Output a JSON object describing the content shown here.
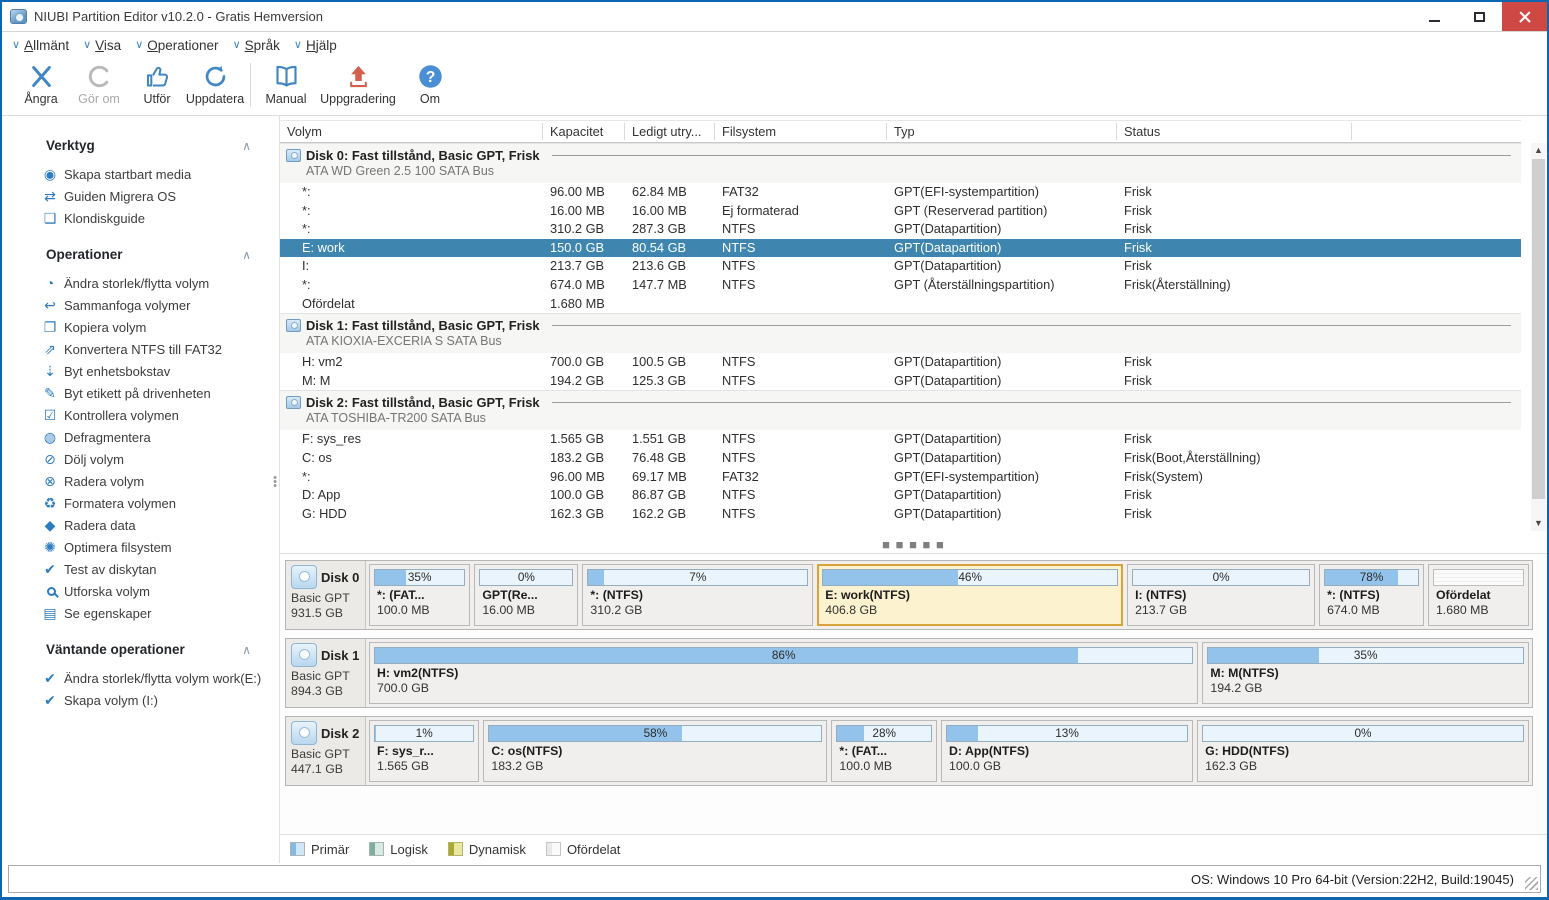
{
  "window": {
    "title": "NIUBI Partition Editor v10.2.0 - Gratis Hemversion"
  },
  "colors": {
    "selected_row": "#3e86af",
    "highlight_border": "#d8a33c",
    "bar_fill": "#93c3ea",
    "close_button": "#cf4944",
    "icon_blue": "#2e7cc0",
    "upgrade_red": "#d2604d"
  },
  "menu": {
    "items": [
      {
        "label": "Allmänt"
      },
      {
        "label": "Visa"
      },
      {
        "label": "Operationer"
      },
      {
        "label": "Språk"
      },
      {
        "label": "Hjälp"
      }
    ]
  },
  "toolbar": {
    "buttons": [
      {
        "label": "Ångra",
        "icon": "undo-icon",
        "enabled": true
      },
      {
        "label": "Gör om",
        "icon": "redo-icon",
        "enabled": false
      },
      {
        "label": "Utför",
        "icon": "apply-thumbsup-icon",
        "enabled": true
      },
      {
        "label": "Uppdatera",
        "icon": "refresh-icon",
        "enabled": true
      },
      {
        "label": "Manual",
        "icon": "manual-book-icon",
        "enabled": true
      },
      {
        "label": "Uppgradering",
        "icon": "upgrade-arrow-icon",
        "enabled": true
      },
      {
        "label": "Om",
        "icon": "about-question-icon",
        "enabled": true
      }
    ]
  },
  "sidebar": {
    "sections": [
      {
        "title": "Verktyg",
        "items": [
          {
            "label": "Skapa startbart media",
            "icon": "bootable-media-icon"
          },
          {
            "label": "Guiden Migrera OS",
            "icon": "migrate-os-icon"
          },
          {
            "label": "Klondiskguide",
            "icon": "clone-disk-icon"
          }
        ]
      },
      {
        "title": "Operationer",
        "items": [
          {
            "label": "Ändra storlek/flytta volym",
            "icon": "resize-move-icon"
          },
          {
            "label": "Sammanfoga volymer",
            "icon": "merge-volumes-icon"
          },
          {
            "label": "Kopiera volym",
            "icon": "copy-volume-icon"
          },
          {
            "label": "Konvertera NTFS till FAT32",
            "icon": "convert-ntfs-icon"
          },
          {
            "label": "Byt enhetsbokstav",
            "icon": "change-drive-letter-icon"
          },
          {
            "label": "Byt etikett på drivenheten",
            "icon": "change-label-icon"
          },
          {
            "label": "Kontrollera volymen",
            "icon": "check-volume-icon"
          },
          {
            "label": "Defragmentera",
            "icon": "defragment-icon"
          },
          {
            "label": "Dölj volym",
            "icon": "hide-volume-icon"
          },
          {
            "label": "Radera volym",
            "icon": "delete-volume-icon"
          },
          {
            "label": "Formatera volymen",
            "icon": "format-volume-icon"
          },
          {
            "label": "Radera data",
            "icon": "wipe-data-icon"
          },
          {
            "label": "Optimera filsystem",
            "icon": "optimize-filesystem-icon"
          },
          {
            "label": "Test av diskytan",
            "icon": "surface-test-icon"
          },
          {
            "label": "Utforska volym",
            "icon": "explore-volume-icon"
          },
          {
            "label": "Se egenskaper",
            "icon": "properties-icon"
          }
        ]
      },
      {
        "title": "Väntande operationer",
        "items": [
          {
            "label": "Ändra storlek/flytta volym  work(E:)",
            "icon": "pending-check-icon"
          },
          {
            "label": "Skapa volym (I:)",
            "icon": "pending-check-icon"
          }
        ]
      }
    ]
  },
  "table": {
    "columns": [
      "Volym",
      "Kapacitet",
      "Ledigt utry...",
      "Filsystem",
      "Typ",
      "Status"
    ],
    "groups": [
      {
        "title": "Disk 0: Fast tillstånd, Basic GPT, Frisk",
        "subtitle": "ATA WD Green 2.5 100 SATA Bus",
        "rows": [
          {
            "volym": "*:",
            "kapacitet": "96.00 MB",
            "ledigt": "62.84 MB",
            "filsystem": "FAT32",
            "typ": "GPT(EFI-systempartition)",
            "status": "Frisk"
          },
          {
            "volym": "*:",
            "kapacitet": "16.00 MB",
            "ledigt": "16.00 MB",
            "filsystem": "Ej formaterad",
            "typ": "GPT (Reserverad partition)",
            "status": "Frisk"
          },
          {
            "volym": "*:",
            "kapacitet": "310.2 GB",
            "ledigt": "287.3 GB",
            "filsystem": "NTFS",
            "typ": "GPT(Datapartition)",
            "status": "Frisk"
          },
          {
            "volym": "E: work",
            "kapacitet": "150.0 GB",
            "ledigt": "80.54 GB",
            "filsystem": "NTFS",
            "typ": "GPT(Datapartition)",
            "status": "Frisk"
          },
          {
            "volym": "I:",
            "kapacitet": "213.7 GB",
            "ledigt": "213.6 GB",
            "filsystem": "NTFS",
            "typ": "GPT(Datapartition)",
            "status": "Frisk"
          },
          {
            "volym": "*:",
            "kapacitet": "674.0 MB",
            "ledigt": "147.7 MB",
            "filsystem": "NTFS",
            "typ": "GPT (Återställningspartition)",
            "status": "Frisk(Återställning)"
          },
          {
            "volym": "Ofördelat",
            "kapacitet": "1.680 MB",
            "ledigt": "",
            "filsystem": "",
            "typ": "",
            "status": ""
          }
        ]
      },
      {
        "title": "Disk 1: Fast tillstånd, Basic GPT, Frisk",
        "subtitle": "ATA KIOXIA-EXCERIA S SATA Bus",
        "rows": [
          {
            "volym": "H: vm2",
            "kapacitet": "700.0 GB",
            "ledigt": "100.5 GB",
            "filsystem": "NTFS",
            "typ": "GPT(Datapartition)",
            "status": "Frisk"
          },
          {
            "volym": "M: M",
            "kapacitet": "194.2 GB",
            "ledigt": "125.3 GB",
            "filsystem": "NTFS",
            "typ": "GPT(Datapartition)",
            "status": "Frisk"
          }
        ]
      },
      {
        "title": "Disk 2: Fast tillstånd, Basic GPT, Frisk",
        "subtitle": "ATA TOSHIBA-TR200 SATA Bus",
        "rows": [
          {
            "volym": "F: sys_res",
            "kapacitet": "1.565 GB",
            "ledigt": "1.551 GB",
            "filsystem": "NTFS",
            "typ": "GPT(Datapartition)",
            "status": "Frisk"
          },
          {
            "volym": "C: os",
            "kapacitet": "183.2 GB",
            "ledigt": "76.48 GB",
            "filsystem": "NTFS",
            "typ": "GPT(Datapartition)",
            "status": "Frisk(Boot,Återställning)"
          },
          {
            "volym": "*:",
            "kapacitet": "96.00 MB",
            "ledigt": "69.17 MB",
            "filsystem": "FAT32",
            "typ": "GPT(EFI-systempartition)",
            "status": "Frisk(System)"
          },
          {
            "volym": "D: App",
            "kapacitet": "100.0 GB",
            "ledigt": "86.87 GB",
            "filsystem": "NTFS",
            "typ": "GPT(Datapartition)",
            "status": "Frisk"
          },
          {
            "volym": "G: HDD",
            "kapacitet": "162.3 GB",
            "ledigt": "162.2 GB",
            "filsystem": "NTFS",
            "typ": "GPT(Datapartition)",
            "status": "Frisk"
          }
        ]
      }
    ]
  },
  "diskmap": {
    "disks": [
      {
        "name": "Disk 0",
        "layout": "Basic GPT",
        "size": "931.5 GB",
        "partitions": [
          {
            "label": "*: (FAT...",
            "size": "100.0 MB",
            "pct": "35%"
          },
          {
            "label": "GPT(Re...",
            "size": "16.00 MB",
            "pct": "0%"
          },
          {
            "label": "*: (NTFS)",
            "size": "310.2 GB",
            "pct": "7%"
          },
          {
            "label": "E: work(NTFS)",
            "size": "406.8 GB",
            "pct": "46%"
          },
          {
            "label": "I: (NTFS)",
            "size": "213.7 GB",
            "pct": "0%"
          },
          {
            "label": "*: (NTFS)",
            "size": "674.0 MB",
            "pct": "78%"
          },
          {
            "label": "Ofördelat",
            "size": "1.680 MB"
          }
        ]
      },
      {
        "name": "Disk 1",
        "layout": "Basic GPT",
        "size": "894.3 GB",
        "partitions": [
          {
            "label": "H: vm2(NTFS)",
            "size": "700.0 GB",
            "pct": "86%"
          },
          {
            "label": "M: M(NTFS)",
            "size": "194.2 GB",
            "pct": "35%"
          }
        ]
      },
      {
        "name": "Disk 2",
        "layout": "Basic GPT",
        "size": "447.1 GB",
        "partitions": [
          {
            "label": "F: sys_r...",
            "size": "1.565 GB",
            "pct": "1%"
          },
          {
            "label": "C: os(NTFS)",
            "size": "183.2 GB",
            "pct": "58%"
          },
          {
            "label": "*: (FAT...",
            "size": "100.0 MB",
            "pct": "28%"
          },
          {
            "label": "D: App(NTFS)",
            "size": "100.0 GB",
            "pct": "13%"
          },
          {
            "label": "G: HDD(NTFS)",
            "size": "162.3 GB",
            "pct": "0%"
          }
        ]
      }
    ]
  },
  "legend": {
    "items": [
      {
        "label": "Primär",
        "color": "#cfe7f9"
      },
      {
        "label": "Logisk",
        "color": "#d9e9e3"
      },
      {
        "label": "Dynamisk",
        "color": "#e8e89e"
      },
      {
        "label": "Ofördelat",
        "color": "#fafafa"
      }
    ]
  },
  "statusbar": {
    "os": "OS: Windows 10 Pro 64-bit (Version:22H2, Build:19045)"
  }
}
